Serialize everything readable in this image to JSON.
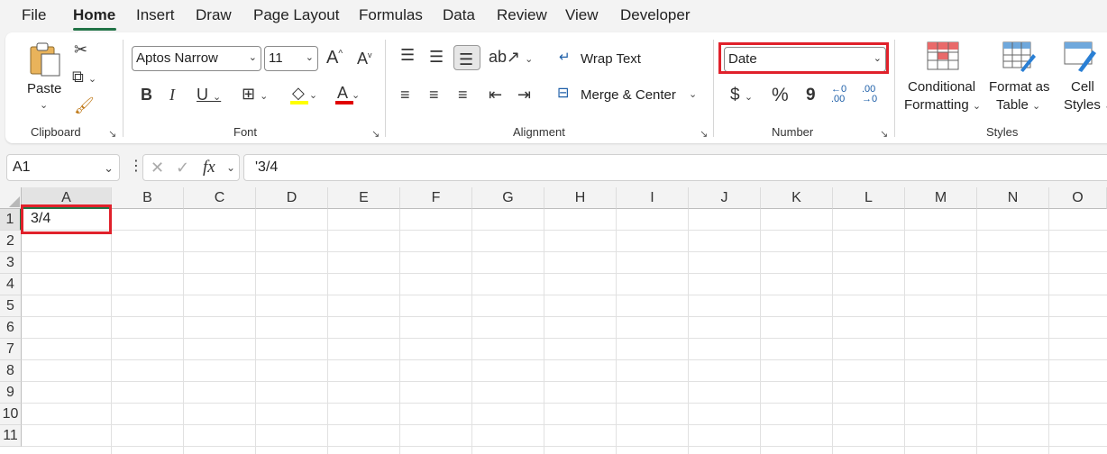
{
  "menu": {
    "tabs": [
      "File",
      "Home",
      "Insert",
      "Draw",
      "Page Layout",
      "Formulas",
      "Data",
      "Review",
      "View",
      "Developer"
    ],
    "active": "Home"
  },
  "clipboard": {
    "paste_label": "Paste",
    "group_label": "Clipboard"
  },
  "font": {
    "name": "Aptos Narrow",
    "size": "11",
    "group_label": "Font"
  },
  "alignment": {
    "wrap_text": "Wrap Text",
    "merge_center": "Merge & Center",
    "group_label": "Alignment"
  },
  "number": {
    "format": "Date",
    "currency": "$",
    "percent": "%",
    "comma": "9",
    "inc_decimal": ".00",
    "dec_decimal": ".00",
    "group_label": "Number"
  },
  "styles": {
    "conditional_1": "Conditional",
    "conditional_2": "Formatting",
    "format_table_1": "Format as",
    "format_table_2": "Table",
    "cell_styles_1": "Cell",
    "cell_styles_2": "Styles",
    "group_label": "Styles"
  },
  "formula_bar": {
    "name_box": "A1",
    "fx": "fx",
    "content": "'3/4"
  },
  "sheet": {
    "columns": [
      "A",
      "B",
      "C",
      "D",
      "E",
      "F",
      "G",
      "H",
      "I",
      "J",
      "K",
      "L",
      "M",
      "N",
      "O"
    ],
    "rows": [
      "1",
      "2",
      "3",
      "4",
      "5",
      "6",
      "7",
      "8",
      "9",
      "10",
      "11"
    ],
    "cells": {
      "A1": "3/4"
    }
  },
  "colors": {
    "accent": "#217346",
    "highlight_box": "#e0212b",
    "fill_yellow": "#ffff00",
    "font_red": "#e00000"
  }
}
